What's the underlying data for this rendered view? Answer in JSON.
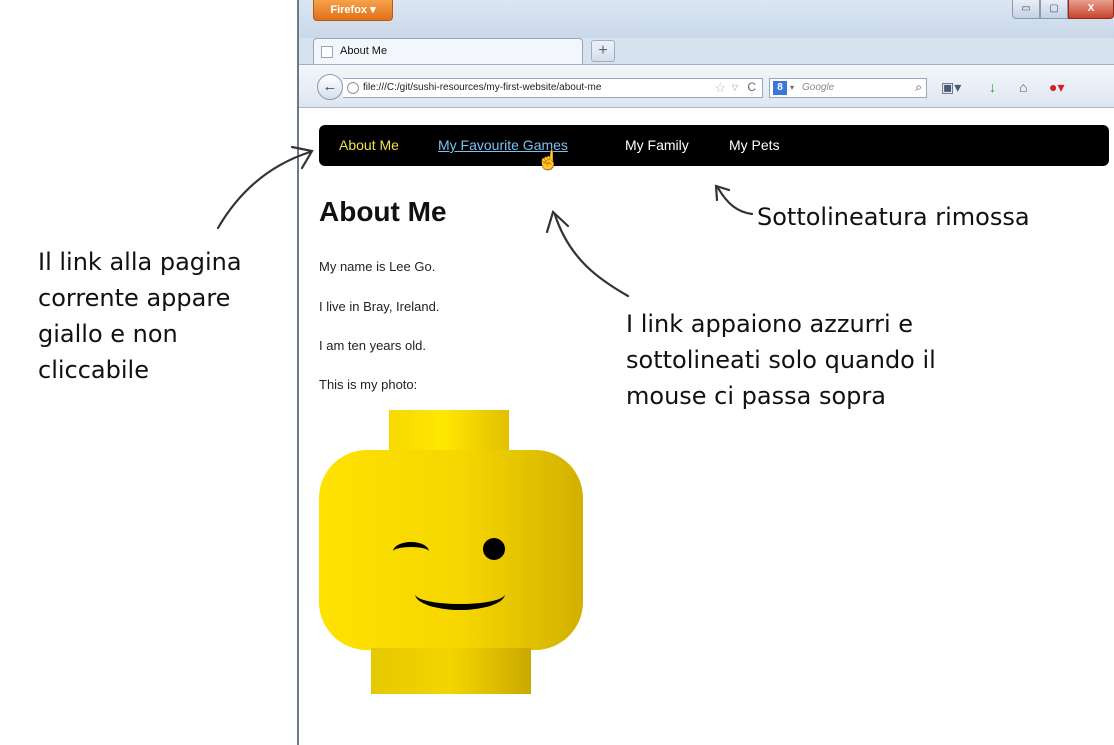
{
  "browser": {
    "app_button": "Firefox ▾",
    "window_controls": {
      "minimize": "▭",
      "maximize": "▢",
      "close": "X"
    },
    "tab_title": "About Me",
    "new_tab": "+",
    "url": "file:///C:/git/sushi-resources/my-first-website/about-me",
    "search_placeholder": "Google",
    "search_engine_icon": "8"
  },
  "site_nav": {
    "items": [
      {
        "label": "About Me",
        "state": "current"
      },
      {
        "label": "My Favourite Games",
        "state": "hover"
      },
      {
        "label": "My Family",
        "state": "normal"
      },
      {
        "label": "My Pets",
        "state": "normal"
      }
    ]
  },
  "page": {
    "heading": "About Me",
    "paragraphs": [
      "My name is Lee Go.",
      "I live in Bray, Ireland.",
      "I am ten years old.",
      "This is my photo:"
    ]
  },
  "annotations": {
    "left_note": [
      "Il link alla pagina",
      "corrente appare",
      "giallo e non",
      "cliccabile"
    ],
    "right_note": [
      "I link appaiono azzurri e",
      "sottolineati solo quando il",
      "mouse ci passa sopra"
    ],
    "top_note": "Sottolineatura rimossa"
  },
  "colors": {
    "current_link": "#f0e34a",
    "hover_link": "#7cc1ef",
    "nav_bg": "#000000"
  }
}
